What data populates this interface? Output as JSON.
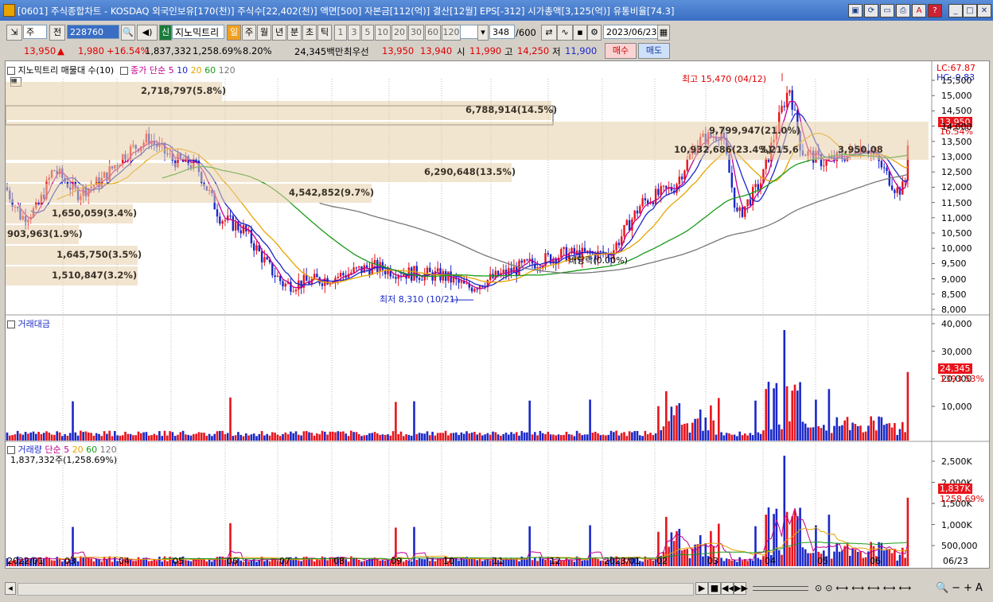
{
  "window": {
    "title": "[0601] 주식종합차트 - KOSDAQ 외국인보유[170(천)] 주식수[22,402(천)] 액면[500] 자본금[112(억)] 결산[12월] EPS[-312] 시가총액[3,125(억)] 유통비율[74.3]"
  },
  "toolbar": {
    "market": "주",
    "prev_label": "전",
    "code": "228760",
    "stock_badge": "신",
    "stock_name": "지노믹트리",
    "periods": [
      "일",
      "주",
      "월",
      "년",
      "분",
      "초",
      "틱"
    ],
    "minutes": [
      "1",
      "3",
      "5",
      "10",
      "20",
      "30",
      "60",
      "120"
    ],
    "count": "348",
    "total": "/600",
    "date": "2023/06/23"
  },
  "quote": {
    "price": "13,950",
    "arrow": "▲",
    "change": "1,980",
    "change_pct": "+16.54%",
    "volume": "1,837,332",
    "volume_pct": "1,258.69%",
    "turnover": "8.20%",
    "amount": "24,345백만",
    "best_label": "최우선",
    "ask": "13,950",
    "bid": "13,940",
    "open_label": "시",
    "open": "11,990",
    "high_label": "고",
    "high": "14,250",
    "low_label": "저",
    "low": "11,900",
    "buy_label": "매수",
    "sell_label": "매도"
  },
  "panel1": {
    "title": "지노믹트리 매물대 수(10)",
    "ma_label": "종가 단순",
    "ma_periods": [
      "5",
      "10",
      "20",
      "60",
      "120"
    ],
    "ma_colors": [
      "#c00090",
      "#1a28c8",
      "#e8a400",
      "#1a9a1a",
      "#777777"
    ],
    "lc": "LC:67.87",
    "hc": "HC:-9.83",
    "high_annot": "최고 15,470 (04/12)",
    "low_annot": "최저 8,310 (10/21)",
    "dividend": "배당락(0.00%)",
    "price_tag": "13,950",
    "price_tag_pct": "16.54%",
    "volume_profile": [
      "2,718,797(5.8%)",
      "6,788,914(14.5%)",
      "9,799,947(21.0%)",
      "10,932,686(23.4%)",
      "6,290,648(13.5%)",
      "4,542,852(9.7%)",
      "1,650,059(3.4%)",
      "903,963(1.9%)",
      "1,645,750(3.5%)",
      "1,510,847(3.2%)"
    ],
    "vp_overlay": [
      "3,215,6",
      "3,950,08"
    ],
    "y_ticks": [
      "15,500",
      "15,000",
      "14,500",
      "14,000",
      "13,500",
      "13,000",
      "12,500",
      "12,000",
      "11,500",
      "11,000",
      "10,500",
      "10,000",
      "9,500",
      "9,000",
      "8,500",
      "8,000"
    ]
  },
  "panel2": {
    "title": "거래대금",
    "y_ticks": [
      "40,000",
      "30,000",
      "20,000",
      "10,000"
    ],
    "tag": "24,345",
    "tag_pct": "1393.53%"
  },
  "panel3": {
    "title": "거래량",
    "ma_label": "단순",
    "ma_periods": [
      "5",
      "20",
      "60",
      "120"
    ],
    "subtitle": "1,837,332주(1,258.69%)",
    "y_ticks": [
      "2,500K",
      "2,000K",
      "1,500K",
      "1,000K",
      "500,000"
    ],
    "tag": "1,837K",
    "tag_pct": "1258.69%"
  },
  "x_axis": [
    "2022/01",
    "03",
    "04",
    "05",
    "06",
    "07",
    "08",
    "09",
    "10",
    "11",
    "12",
    "2023/01",
    "02",
    "03",
    "04",
    "05",
    "06"
  ],
  "x_end": "06/23",
  "colors": {
    "up": "#e8141b",
    "down": "#1a28c8",
    "bg": "#ffffff",
    "chrome": "#d4d0c8"
  }
}
